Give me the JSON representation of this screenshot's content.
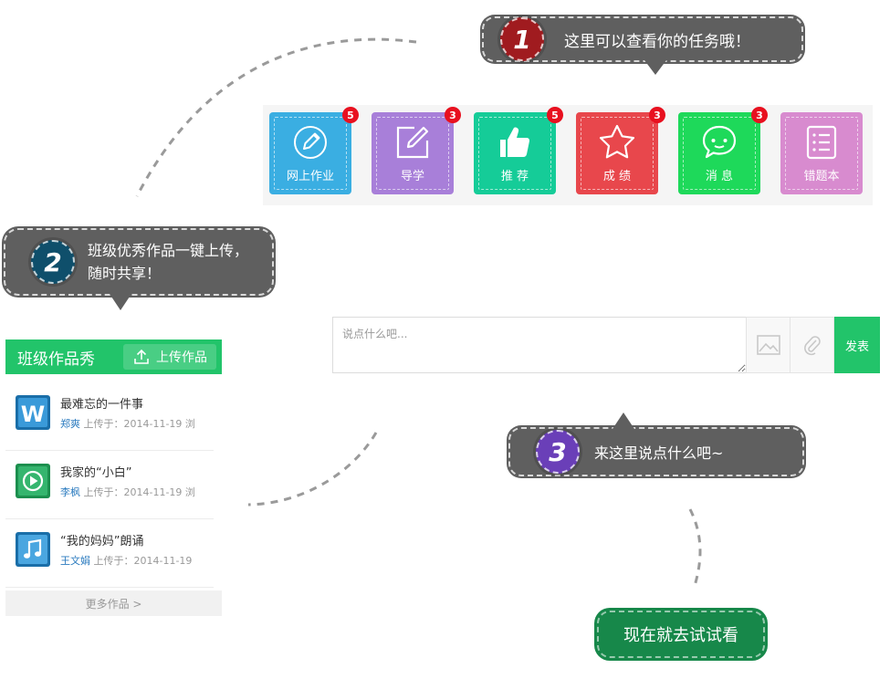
{
  "colors": {
    "bubble": "#5f5f5f",
    "badge1": "#a01b1f",
    "badge2": "#0f4f6b",
    "badge3": "#6a3fb8",
    "green": "#22c46a",
    "cta": "#17884a"
  },
  "tips": {
    "tip1": {
      "number": "1",
      "text": "这里可以查看你的任务哦！"
    },
    "tip2": {
      "number": "2",
      "line1": "班级优秀作品一键上传，",
      "line2": "随时共享！"
    },
    "tip3": {
      "number": "3",
      "text": "来这里说点什么吧~"
    }
  },
  "tiles": [
    {
      "label": "网上作业",
      "badge": "5",
      "color": "#3aaee2",
      "icon": "pencil-circle-icon"
    },
    {
      "label": "导学",
      "badge": "3",
      "color": "#a87fd9",
      "icon": "edit-square-icon"
    },
    {
      "label": "推 荐",
      "badge": "5",
      "color": "#15cc98",
      "icon": "thumbs-up-icon"
    },
    {
      "label": "成 绩",
      "badge": "3",
      "color": "#e8474c",
      "icon": "star-icon"
    },
    {
      "label": "消 息",
      "badge": "3",
      "color": "#1ed95a",
      "icon": "chat-bubble-icon"
    },
    {
      "label": "错题本",
      "badge": "",
      "color": "#d88bcf",
      "icon": "list-note-icon"
    }
  ],
  "works": {
    "title": "班级作品秀",
    "upload_label": "上传作品",
    "items": [
      {
        "title": "最难忘的一件事",
        "author": "郑爽",
        "meta": " 上传于：2014-11-19   浏",
        "icon": "word-doc-icon"
      },
      {
        "title": "我家的“小白”",
        "author": "李枫",
        "meta": " 上传于：2014-11-19   浏",
        "icon": "video-play-icon"
      },
      {
        "title": "“我的妈妈”朗诵",
        "author": "王文娟",
        "meta": " 上传于：2014-11-19",
        "icon": "music-note-icon"
      }
    ],
    "more_label": "更多作品 >"
  },
  "compose": {
    "placeholder": "说点什么吧...",
    "publish_label": "发表"
  },
  "cta_label": "现在就去试试看"
}
